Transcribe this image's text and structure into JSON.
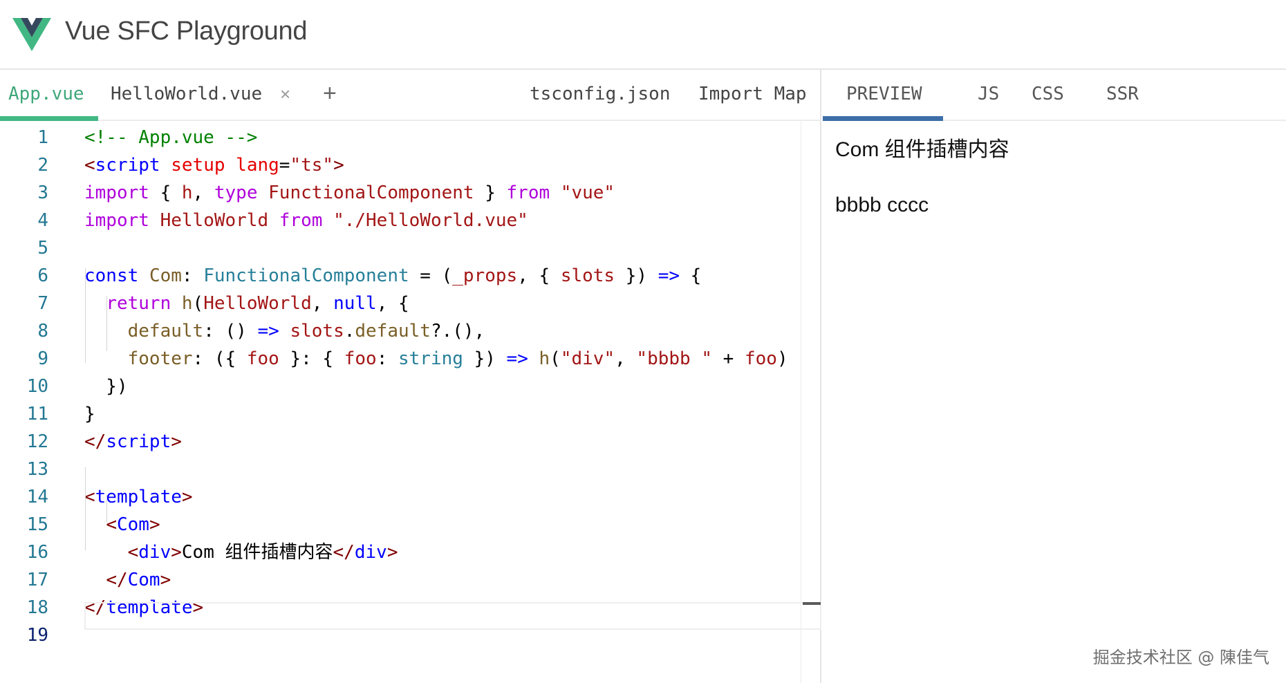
{
  "header": {
    "title": "Vue SFC Playground",
    "logo_icon": "vue-logo-icon"
  },
  "editor": {
    "tabs": [
      {
        "label": "App.vue",
        "active": true
      },
      {
        "label": "HelloWorld.vue",
        "active": false
      }
    ],
    "close_glyph": "×",
    "add_glyph": "+",
    "right_tabs": [
      {
        "label": "tsconfig.json"
      },
      {
        "label": "Import Map"
      }
    ],
    "line_numbers": [
      "1",
      "2",
      "3",
      "4",
      "5",
      "6",
      "7",
      "8",
      "9",
      "10",
      "11",
      "12",
      "13",
      "14",
      "15",
      "16",
      "17",
      "18",
      "19"
    ],
    "current_line": 19,
    "lines": [
      [
        {
          "t": "<!-- App.vue -->",
          "c": "t-comment"
        }
      ],
      [
        {
          "t": "<",
          "c": "t-tag"
        },
        {
          "t": "script",
          "c": "t-tagname"
        },
        {
          "t": " ",
          "c": ""
        },
        {
          "t": "setup",
          "c": "t-attr"
        },
        {
          "t": " ",
          "c": ""
        },
        {
          "t": "lang",
          "c": "t-attr"
        },
        {
          "t": "=",
          "c": ""
        },
        {
          "t": "\"ts\"",
          "c": "t-str"
        },
        {
          "t": ">",
          "c": "t-tag"
        }
      ],
      [
        {
          "t": "import",
          "c": "t-kw"
        },
        {
          "t": " { ",
          "c": ""
        },
        {
          "t": "h",
          "c": "t-red"
        },
        {
          "t": ", ",
          "c": ""
        },
        {
          "t": "type",
          "c": "t-kw"
        },
        {
          "t": " ",
          "c": ""
        },
        {
          "t": "FunctionalComponent",
          "c": "t-red"
        },
        {
          "t": " } ",
          "c": ""
        },
        {
          "t": "from",
          "c": "t-kw"
        },
        {
          "t": " ",
          "c": ""
        },
        {
          "t": "\"vue\"",
          "c": "t-str"
        }
      ],
      [
        {
          "t": "import",
          "c": "t-kw"
        },
        {
          "t": " ",
          "c": ""
        },
        {
          "t": "HelloWorld",
          "c": "t-red"
        },
        {
          "t": " ",
          "c": ""
        },
        {
          "t": "from",
          "c": "t-kw"
        },
        {
          "t": " ",
          "c": ""
        },
        {
          "t": "\"./HelloWorld.vue\"",
          "c": "t-str"
        }
      ],
      [],
      [
        {
          "t": "const",
          "c": "t-kw2"
        },
        {
          "t": " ",
          "c": ""
        },
        {
          "t": "Com",
          "c": "t-fn"
        },
        {
          "t": ": ",
          "c": ""
        },
        {
          "t": "FunctionalComponent",
          "c": "t-type"
        },
        {
          "t": " = (",
          "c": ""
        },
        {
          "t": "_props",
          "c": "t-red"
        },
        {
          "t": ", { ",
          "c": ""
        },
        {
          "t": "slots",
          "c": "t-red"
        },
        {
          "t": " }) ",
          "c": ""
        },
        {
          "t": "=>",
          "c": "t-kw2"
        },
        {
          "t": " {",
          "c": ""
        }
      ],
      [
        {
          "t": "  ",
          "c": ""
        },
        {
          "t": "return",
          "c": "t-kw"
        },
        {
          "t": " ",
          "c": ""
        },
        {
          "t": "h",
          "c": "t-fn"
        },
        {
          "t": "(",
          "c": ""
        },
        {
          "t": "HelloWorld",
          "c": "t-red"
        },
        {
          "t": ", ",
          "c": ""
        },
        {
          "t": "null",
          "c": "t-kw2"
        },
        {
          "t": ", {",
          "c": ""
        }
      ],
      [
        {
          "t": "    ",
          "c": ""
        },
        {
          "t": "default",
          "c": "t-fn"
        },
        {
          "t": ": () ",
          "c": ""
        },
        {
          "t": "=>",
          "c": "t-kw2"
        },
        {
          "t": " ",
          "c": ""
        },
        {
          "t": "slots",
          "c": "t-red"
        },
        {
          "t": ".",
          "c": ""
        },
        {
          "t": "default",
          "c": "t-fn"
        },
        {
          "t": "?.(),",
          "c": ""
        }
      ],
      [
        {
          "t": "    ",
          "c": ""
        },
        {
          "t": "footer",
          "c": "t-fn"
        },
        {
          "t": ": ({ ",
          "c": ""
        },
        {
          "t": "foo",
          "c": "t-red"
        },
        {
          "t": " }: { ",
          "c": ""
        },
        {
          "t": "foo",
          "c": "t-red"
        },
        {
          "t": ": ",
          "c": ""
        },
        {
          "t": "string",
          "c": "t-type"
        },
        {
          "t": " }) ",
          "c": ""
        },
        {
          "t": "=>",
          "c": "t-kw2"
        },
        {
          "t": " ",
          "c": ""
        },
        {
          "t": "h",
          "c": "t-fn"
        },
        {
          "t": "(",
          "c": ""
        },
        {
          "t": "\"div\"",
          "c": "t-str"
        },
        {
          "t": ", ",
          "c": ""
        },
        {
          "t": "\"bbbb \"",
          "c": "t-str"
        },
        {
          "t": " + ",
          "c": ""
        },
        {
          "t": "foo",
          "c": "t-red"
        },
        {
          "t": ")",
          "c": ""
        }
      ],
      [
        {
          "t": "  })",
          "c": ""
        }
      ],
      [
        {
          "t": "}",
          "c": ""
        }
      ],
      [
        {
          "t": "</",
          "c": "t-tag"
        },
        {
          "t": "script",
          "c": "t-tagname"
        },
        {
          "t": ">",
          "c": "t-tag"
        }
      ],
      [],
      [
        {
          "t": "<",
          "c": "t-tag"
        },
        {
          "t": "template",
          "c": "t-tagname"
        },
        {
          "t": ">",
          "c": "t-tag"
        }
      ],
      [
        {
          "t": "  ",
          "c": ""
        },
        {
          "t": "<",
          "c": "t-tag"
        },
        {
          "t": "Com",
          "c": "t-tagname"
        },
        {
          "t": ">",
          "c": "t-tag"
        }
      ],
      [
        {
          "t": "    ",
          "c": ""
        },
        {
          "t": "<",
          "c": "t-tag"
        },
        {
          "t": "div",
          "c": "t-tagname"
        },
        {
          "t": ">",
          "c": "t-tag"
        },
        {
          "t": "Com 组件插槽内容",
          "c": ""
        },
        {
          "t": "</",
          "c": "t-tag"
        },
        {
          "t": "div",
          "c": "t-tagname"
        },
        {
          "t": ">",
          "c": "t-tag"
        }
      ],
      [
        {
          "t": "  ",
          "c": ""
        },
        {
          "t": "</",
          "c": "t-tag"
        },
        {
          "t": "Com",
          "c": "t-tagname"
        },
        {
          "t": ">",
          "c": "t-tag"
        }
      ],
      [
        {
          "t": "</",
          "c": "t-tag"
        },
        {
          "t": "template",
          "c": "t-tagname"
        },
        {
          "t": ">",
          "c": "t-tag"
        }
      ],
      []
    ]
  },
  "preview": {
    "tabs": [
      {
        "label": "PREVIEW",
        "active": true
      },
      {
        "label": "JS",
        "active": false
      },
      {
        "label": "CSS",
        "active": false
      },
      {
        "label": "SSR",
        "active": false
      }
    ],
    "output_line1": "Com 组件插槽内容",
    "output_line2": "bbbb cccc"
  },
  "watermark": "掘金技术社区 @ 陳佳气",
  "colors": {
    "accent": "#42b883",
    "preview_tab_accent": "#3d6ea8",
    "logo_green": "#41b883",
    "logo_dark": "#35495e"
  }
}
